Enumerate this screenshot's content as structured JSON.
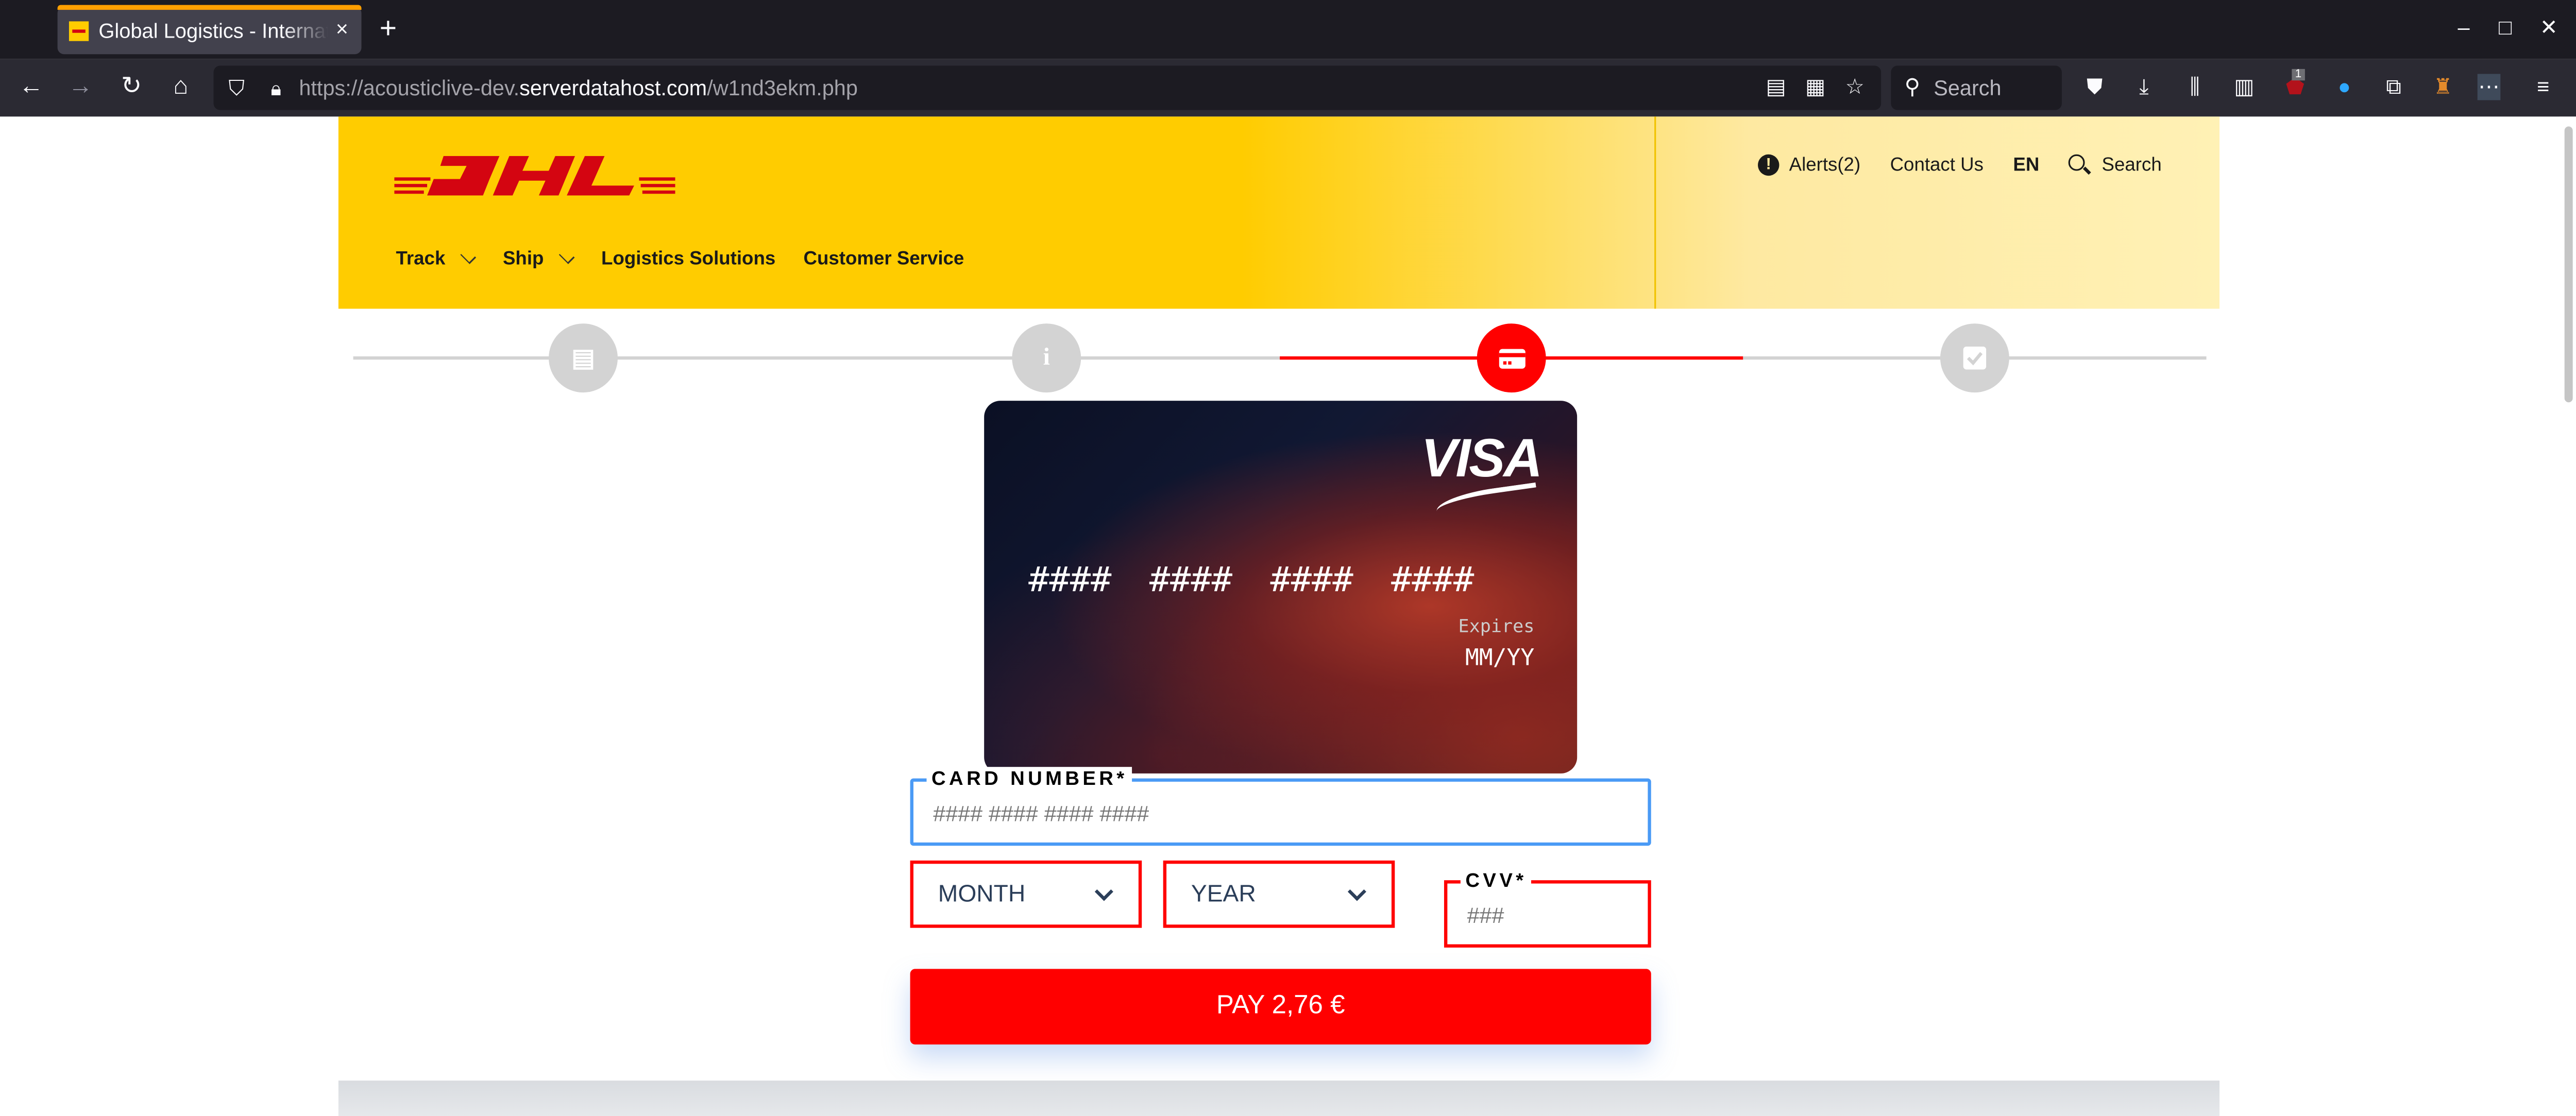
{
  "browser": {
    "tab_title": "Global Logistics - International",
    "tab_close": "×",
    "new_tab": "+",
    "url_prefix": "https://acousticlive-dev.",
    "url_domain": "serverdatahost.com",
    "url_path": "/w1nd3ekm.php",
    "search_placeholder": "Search",
    "extension_badge": "1",
    "window_controls": {
      "minimize": "–",
      "maximize": "□",
      "close": "✕"
    }
  },
  "header": {
    "logo_text": "DHL",
    "nav": [
      {
        "label": "Track",
        "dropdown": true
      },
      {
        "label": "Ship",
        "dropdown": true
      },
      {
        "label": "Logistics Solutions",
        "dropdown": false
      },
      {
        "label": "Customer Service",
        "dropdown": false
      }
    ],
    "util": {
      "alerts": "Alerts(2)",
      "alert_icon": "!",
      "contact": "Contact Us",
      "language": "EN",
      "search": "Search"
    },
    "brand_colors": {
      "yellow": "#ffcc00",
      "red": "#d40511"
    }
  },
  "stepper": {
    "steps": [
      {
        "icon": "id-card-icon",
        "glyph": "▤",
        "state": "done"
      },
      {
        "icon": "info-icon",
        "glyph": "i",
        "state": "done"
      },
      {
        "icon": "credit-card-icon",
        "glyph": "▭",
        "state": "active"
      },
      {
        "icon": "check-icon",
        "glyph": "✓",
        "state": "pending"
      }
    ],
    "active_color": "#ff0000",
    "inactive_color": "#d3d3d3"
  },
  "card_preview": {
    "brand": "VISA",
    "number_groups": [
      "####",
      "####",
      "####",
      "####"
    ],
    "expires_label": "Expires",
    "expires_value": "MM/YY"
  },
  "form": {
    "card_number_label": "CARD NUMBER*",
    "card_number_placeholder": "#### #### #### ####",
    "card_number_value": "",
    "month_selected": "MONTH",
    "year_selected": "YEAR",
    "cvv_label": "CVV*",
    "cvv_placeholder": "###",
    "cvv_value": "",
    "pay_button": "PAY 2,76 €",
    "focus_color": "#4a9af5",
    "error_color": "#ff0000"
  }
}
